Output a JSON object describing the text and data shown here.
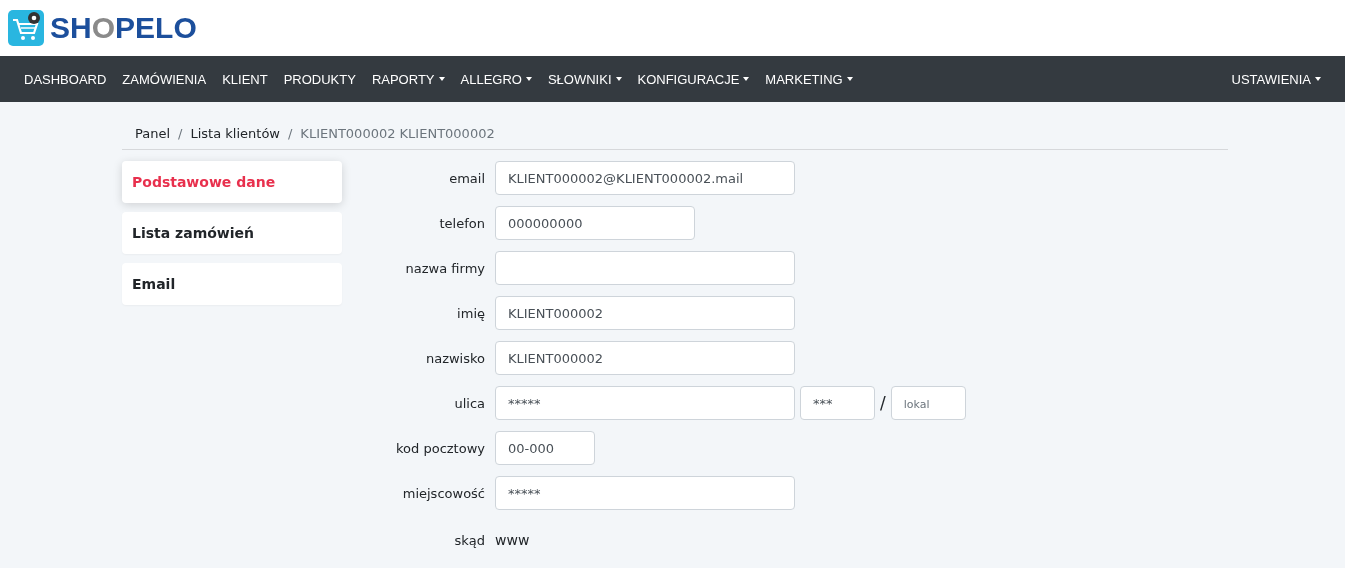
{
  "logo": {
    "parts": [
      {
        "text": "SH",
        "accent": false
      },
      {
        "text": "O",
        "accent": true
      },
      {
        "text": "PELO",
        "accent": false
      }
    ]
  },
  "nav": {
    "items": [
      {
        "label": "DASHBOARD",
        "dropdown": false
      },
      {
        "label": "ZAMÓWIENIA",
        "dropdown": false
      },
      {
        "label": "KLIENT",
        "dropdown": false
      },
      {
        "label": "PRODUKTY",
        "dropdown": false
      },
      {
        "label": "RAPORTY",
        "dropdown": true
      },
      {
        "label": "ALLEGRO ",
        "dropdown": true
      },
      {
        "label": "SŁOWNIKI",
        "dropdown": true
      },
      {
        "label": "KONFIGURACJE",
        "dropdown": true
      },
      {
        "label": "MARKETING",
        "dropdown": true
      }
    ],
    "right": {
      "label": "USTAWIENIA",
      "dropdown": true
    }
  },
  "breadcrumb": {
    "separator": "/",
    "items": [
      {
        "label": "Panel",
        "current": false
      },
      {
        "label": "Lista klientów",
        "current": false
      },
      {
        "label": "KLIENT000002 KLIENT000002",
        "current": true
      }
    ]
  },
  "sidebar": {
    "items": [
      {
        "label": "Podstawowe dane",
        "selected": true
      },
      {
        "label": "Lista zamówień",
        "selected": false
      },
      {
        "label": "Email",
        "selected": false
      }
    ]
  },
  "form": {
    "rows": [
      {
        "kind": "input",
        "label": "email",
        "inputs": [
          {
            "kind": "text",
            "value": "KLIENT000002@KLIENT000002.mail"
          }
        ]
      },
      {
        "kind": "input",
        "label": "telefon",
        "inputs": [
          {
            "kind": "phone",
            "value": "000000000"
          }
        ]
      },
      {
        "kind": "input",
        "label": "nazwa firmy",
        "inputs": [
          {
            "kind": "text"
          }
        ]
      },
      {
        "kind": "input",
        "label": "imię",
        "inputs": [
          {
            "kind": "text",
            "value": "KLIENT000002"
          }
        ]
      },
      {
        "kind": "input",
        "label": "nazwisko",
        "inputs": [
          {
            "kind": "text",
            "value": "KLIENT000002"
          }
        ]
      },
      {
        "kind": "input",
        "label": "ulica",
        "separator": "/",
        "inputs": [
          {
            "kind": "text",
            "value": "*****"
          },
          {
            "kind": "number",
            "value": "***"
          },
          {
            "kind": "number",
            "placeholder": "lokal"
          }
        ]
      },
      {
        "kind": "input",
        "label": "kod pocztowy",
        "inputs": [
          {
            "kind": "postcode",
            "value": "00-000"
          }
        ]
      },
      {
        "kind": "input",
        "label": "miejscowość",
        "inputs": [
          {
            "kind": "text",
            "value": "*****"
          }
        ]
      },
      {
        "kind": "static",
        "label": "skąd",
        "value": "www"
      }
    ]
  }
}
